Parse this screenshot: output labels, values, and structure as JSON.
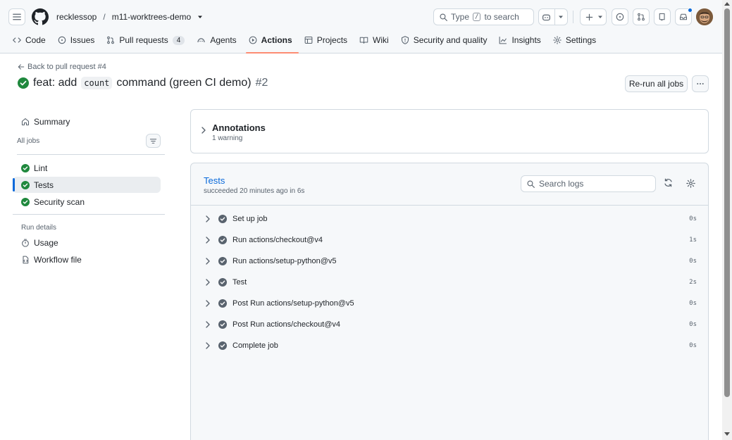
{
  "header": {
    "owner": "recklessop",
    "separator": "/",
    "repo": "m11-worktrees-demo",
    "search_prefix": "Type",
    "search_key": "/",
    "search_suffix": "to search"
  },
  "nav": {
    "tabs": [
      {
        "label": "Code",
        "icon": "code-icon"
      },
      {
        "label": "Issues",
        "icon": "issue-icon"
      },
      {
        "label": "Pull requests",
        "icon": "pull-request-icon",
        "count": "4"
      },
      {
        "label": "Agents",
        "icon": "agents-icon"
      },
      {
        "label": "Actions",
        "icon": "play-icon",
        "active": true
      },
      {
        "label": "Projects",
        "icon": "table-icon"
      },
      {
        "label": "Wiki",
        "icon": "book-icon"
      },
      {
        "label": "Security and quality",
        "icon": "shield-icon"
      },
      {
        "label": "Insights",
        "icon": "graph-icon"
      },
      {
        "label": "Settings",
        "icon": "gear-icon"
      }
    ]
  },
  "run": {
    "back_link": "Back to pull request #4",
    "title_prefix": "feat: add",
    "title_code": "count",
    "title_suffix": "command (green CI demo)",
    "run_number": "#2",
    "rerun_label": "Re-run all jobs"
  },
  "sidebar": {
    "summary": "Summary",
    "all_jobs_label": "All jobs",
    "jobs": [
      "Lint",
      "Tests",
      "Security scan"
    ],
    "selected_job": "Tests",
    "run_details_label": "Run details",
    "usage": "Usage",
    "workflow_file": "Workflow file"
  },
  "annotations": {
    "title": "Annotations",
    "subtitle": "1 warning"
  },
  "job": {
    "name": "Tests",
    "status": "succeeded 20 minutes ago in 6s",
    "search_placeholder": "Search logs",
    "steps": [
      {
        "name": "Set up job",
        "duration": "0s"
      },
      {
        "name": "Run actions/checkout@v4",
        "duration": "1s"
      },
      {
        "name": "Run actions/setup-python@v5",
        "duration": "0s"
      },
      {
        "name": "Test",
        "duration": "2s"
      },
      {
        "name": "Post Run actions/setup-python@v5",
        "duration": "0s"
      },
      {
        "name": "Post Run actions/checkout@v4",
        "duration": "0s"
      },
      {
        "name": "Complete job",
        "duration": "0s"
      }
    ]
  },
  "colors": {
    "success": "#1f883d",
    "step_check": "#59636e",
    "link": "#0969da",
    "active_tab_underline": "#fd8c73"
  }
}
